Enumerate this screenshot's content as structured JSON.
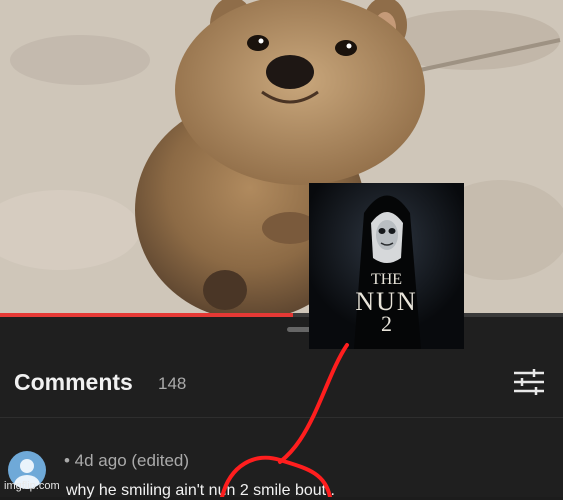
{
  "video": {
    "progress_fraction": 0.52
  },
  "poster": {
    "title_line1": "THE",
    "title_line2": "NUN",
    "title_line3": "2"
  },
  "comments": {
    "title": "Comments",
    "count": "148",
    "filter_icon": "sliders-icon"
  },
  "comment": {
    "meta": "• 4d ago (edited)",
    "text": "why he smiling ain't nun 2 smile bout ."
  },
  "watermark": "imgflip.com",
  "colors": {
    "accent": "#e53935",
    "panel_bg": "#1f1f1f",
    "text_primary": "#f1f1f1",
    "text_secondary": "#aaaaaa",
    "avatar": "#6fa9d8",
    "annotation": "#ff1e1e"
  }
}
